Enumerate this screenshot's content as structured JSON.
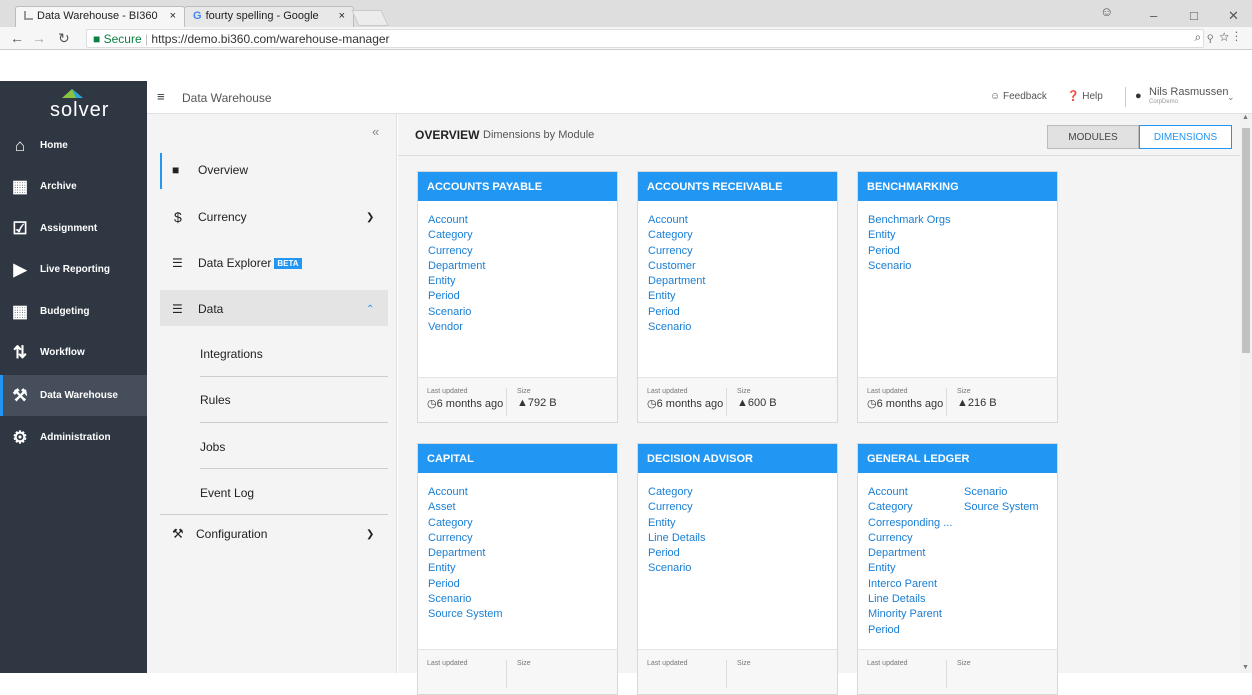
{
  "browser": {
    "tabs": [
      {
        "label": "Data Warehouse - BI360"
      },
      {
        "label": "fourty spelling - Google"
      }
    ],
    "tab_close": "×",
    "secure_label": "Secure",
    "url": "https://demo.bi360.com/warehouse-manager"
  },
  "app": {
    "logo_text": "solver",
    "page_title": "Data Warehouse",
    "feedback_label": "Feedback",
    "help_label": "Help",
    "user_name": "Nils Rasmussen",
    "user_sub": "CorpDemo"
  },
  "leftnav": {
    "items": [
      {
        "label": "Home",
        "icon": "home-icon"
      },
      {
        "label": "Archive",
        "icon": "archive-icon"
      },
      {
        "label": "Assignment",
        "icon": "assignment-icon"
      },
      {
        "label": "Live Reporting",
        "icon": "live-reporting-icon"
      },
      {
        "label": "Budgeting",
        "icon": "calculator-icon"
      },
      {
        "label": "Workflow",
        "icon": "workflow-icon"
      },
      {
        "label": "Data Warehouse",
        "icon": "tools-icon"
      },
      {
        "label": "Administration",
        "icon": "gear-icon"
      }
    ],
    "active": "Data Warehouse"
  },
  "subnav": {
    "collapse": "«",
    "overview": "Overview",
    "currency": "Currency",
    "data_explorer": "Data Explorer",
    "beta": "BETA",
    "data": "Data",
    "children": [
      "Integrations",
      "Rules",
      "Jobs",
      "Event Log"
    ],
    "configuration": "Configuration"
  },
  "main": {
    "heading": "OVERVIEW",
    "subheading": "Dimensions by Module",
    "toggle_modules": "MODULES",
    "toggle_dimensions": "DIMENSIONS",
    "last_updated_label": "Last updated",
    "size_label": "Size",
    "cards": [
      {
        "title": "ACCOUNTS PAYABLE",
        "links": [
          "Account",
          "Category",
          "Currency",
          "Department",
          "Entity",
          "Period",
          "Scenario",
          "Vendor"
        ],
        "updated": "6 months ago",
        "size": "792 B"
      },
      {
        "title": "ACCOUNTS RECEIVABLE",
        "links": [
          "Account",
          "Category",
          "Currency",
          "Customer",
          "Department",
          "Entity",
          "Period",
          "Scenario"
        ],
        "updated": "6 months ago",
        "size": "600 B"
      },
      {
        "title": "BENCHMARKING",
        "links": [
          "Benchmark Orgs",
          "Entity",
          "Period",
          "Scenario"
        ],
        "updated": "6 months ago",
        "size": "216 B"
      },
      {
        "title": "CAPITAL",
        "links": [
          "Account",
          "Asset",
          "Category",
          "Currency",
          "Department",
          "Entity",
          "Period",
          "Scenario",
          "Source System"
        ]
      },
      {
        "title": "DECISION ADVISOR",
        "links": [
          "Category",
          "Currency",
          "Entity",
          "Line Details",
          "Period",
          "Scenario"
        ]
      },
      {
        "title": "GENERAL LEDGER",
        "links": [
          "Account",
          "Category",
          "Corresponding ...",
          "Currency",
          "Department",
          "Entity",
          "Interco Parent",
          "Line Details",
          "Minority Parent",
          "Period"
        ],
        "links2": [
          "Scenario",
          "Source System"
        ]
      }
    ]
  },
  "colors": {
    "accent": "#2196f3",
    "nav_bg": "#2f3742"
  }
}
